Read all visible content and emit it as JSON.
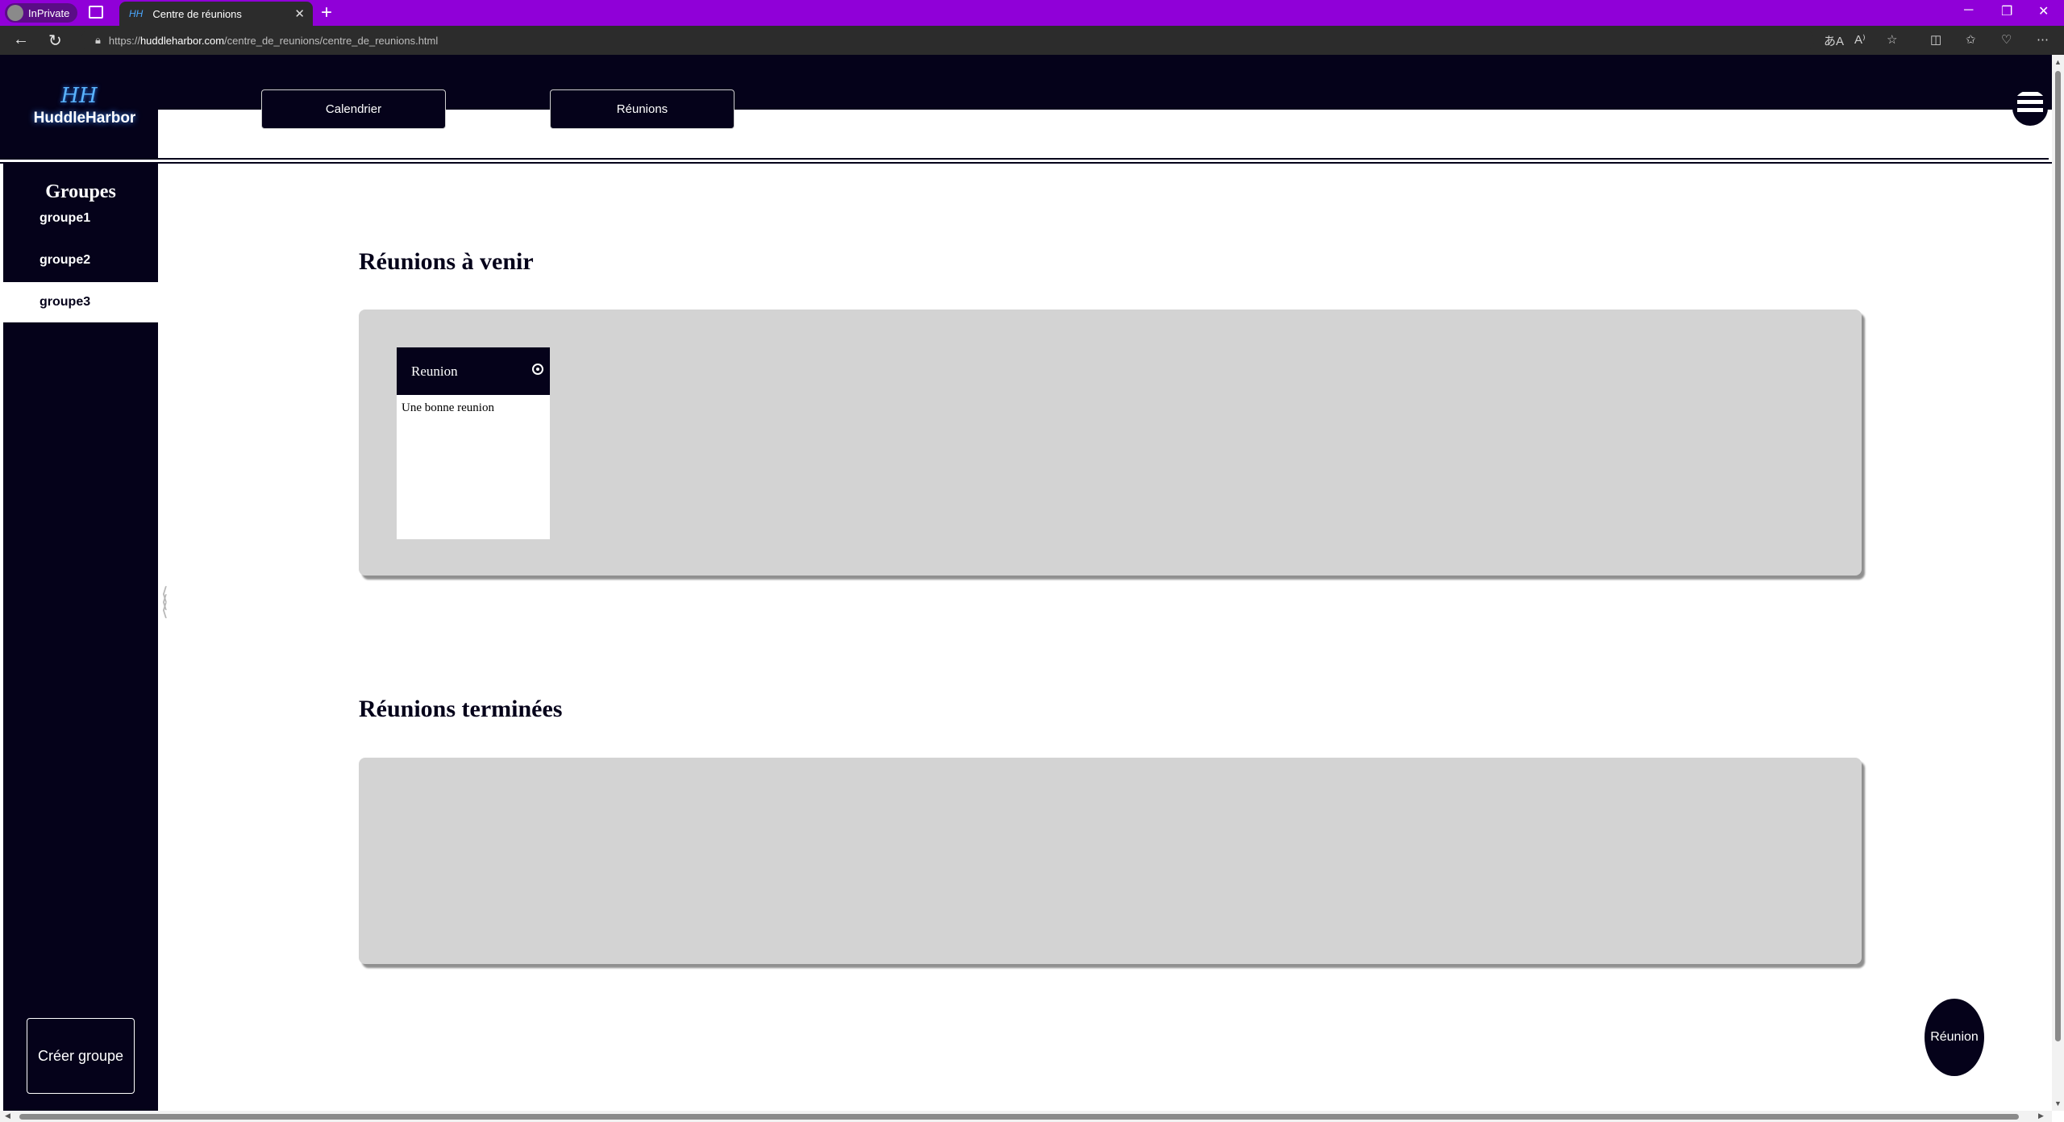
{
  "browser": {
    "inprivate_label": "InPrivate",
    "tab_title": "Centre de réunions",
    "tab_favicon": "HH",
    "url_scheme": "https://",
    "url_host": "huddleharbor.com",
    "url_path": "/centre_de_reunions/centre_de_reunions.html"
  },
  "app": {
    "logo_mark": "HH",
    "logo_text": "HuddleHarbor",
    "nav": {
      "calendar_label": "Calendrier",
      "meetings_label": "Réunions"
    }
  },
  "sidebar": {
    "title": "Groupes",
    "items": [
      {
        "label": "groupe1"
      },
      {
        "label": "groupe2"
      },
      {
        "label": "groupe3"
      }
    ],
    "active_item": "groupe3",
    "create_label": "Créer groupe"
  },
  "main": {
    "upcoming_title": "Réunions à venir",
    "upcoming": [
      {
        "title": "Reunion",
        "description": "Une bonne reunion"
      }
    ],
    "finished_title": "Réunions terminées",
    "finished": []
  },
  "fab_label": "Réunion",
  "colors": {
    "brand_dark": "#05021a",
    "panel_gray": "#d3d3d3",
    "browser_accent": "#9000d8"
  }
}
